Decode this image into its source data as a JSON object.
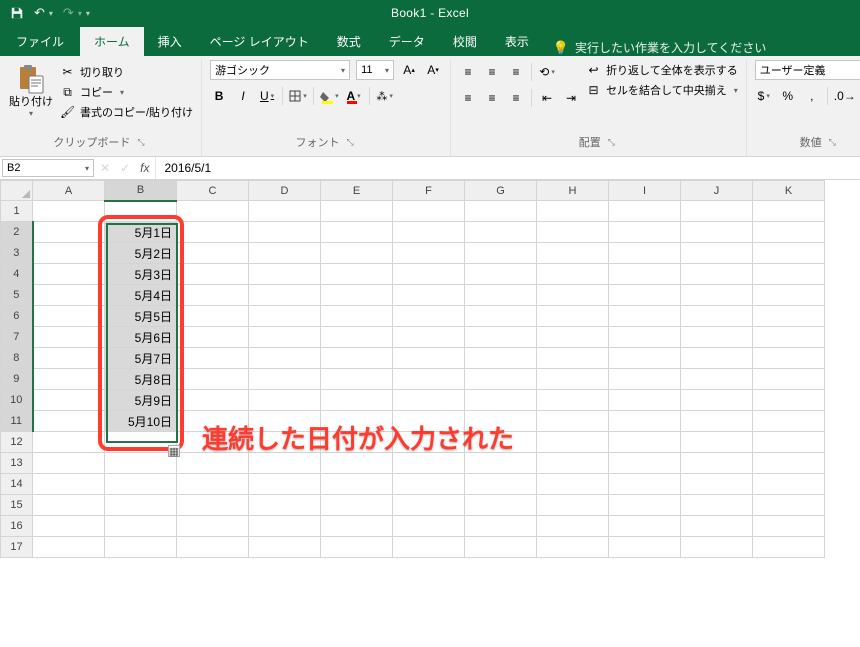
{
  "title": "Book1 - Excel",
  "qat": {
    "save": "save",
    "undo": "undo",
    "redo": "redo"
  },
  "tabs": {
    "items": [
      "ファイル",
      "ホーム",
      "挿入",
      "ページ レイアウト",
      "数式",
      "データ",
      "校閲",
      "表示"
    ],
    "active": 1,
    "tell_me": "実行したい作業を入力してください"
  },
  "ribbon": {
    "clipboard": {
      "label": "クリップボード",
      "paste": "貼り付け",
      "cut": "切り取り",
      "copy": "コピー",
      "format_painter": "書式のコピー/貼り付け"
    },
    "font": {
      "label": "フォント",
      "name": "游ゴシック",
      "size": "11",
      "bold": "B",
      "italic": "I",
      "underline": "U"
    },
    "align": {
      "label": "配置",
      "wrap": "折り返して全体を表示する",
      "merge": "セルを結合して中央揃え"
    },
    "number": {
      "label": "数値",
      "format": "ユーザー定義"
    }
  },
  "formula_bar": {
    "name_box": "B2",
    "fx": "fx",
    "value": "2016/5/1"
  },
  "sheet": {
    "columns": [
      "A",
      "B",
      "C",
      "D",
      "E",
      "F",
      "G",
      "H",
      "I",
      "J",
      "K"
    ],
    "rows": 17,
    "selected_col": 1,
    "selected_rows": [
      2,
      11
    ],
    "data": {
      "B2": "5月1日",
      "B3": "5月2日",
      "B4": "5月3日",
      "B5": "5月4日",
      "B6": "5月5日",
      "B7": "5月6日",
      "B8": "5月7日",
      "B9": "5月8日",
      "B10": "5月9日",
      "B11": "5月10日"
    }
  },
  "annotation": {
    "text": "連続した日付が入力された"
  }
}
